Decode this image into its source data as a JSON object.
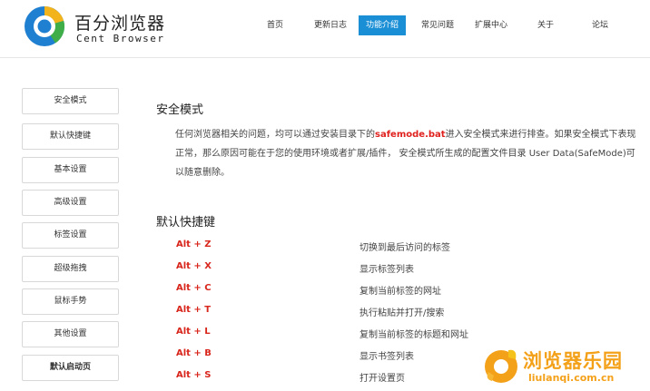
{
  "header": {
    "logo_cn": "百分浏览器",
    "logo_en": "Cent Browser",
    "nav": [
      {
        "label": "首页"
      },
      {
        "label": "更新日志"
      },
      {
        "label": "功能介绍",
        "active": true
      },
      {
        "label": "常见问题"
      },
      {
        "label": "扩展中心"
      },
      {
        "label": "关于"
      },
      {
        "label": "论坛"
      }
    ]
  },
  "sidebar": {
    "items": [
      {
        "label": "安全模式"
      },
      {
        "label": "默认快捷键"
      },
      {
        "label": "基本设置"
      },
      {
        "label": "高级设置"
      },
      {
        "label": "标签设置"
      },
      {
        "label": "超级拖拽"
      },
      {
        "label": "鼠标手势"
      },
      {
        "label": "其他设置"
      },
      {
        "label": "默认启动页",
        "active": true
      }
    ]
  },
  "safe_mode": {
    "title": "安全模式",
    "text_before": "任何浏览器相关的问题，均可以通过安装目录下的",
    "highlight": "safemode.bat",
    "text_after": "进入安全模式来进行排查。如果安全模式下表现正常，那么原因可能在于您的使用环境或者扩展/插件， 安全模式所生成的配置文件目录 User Data(SafeMode)可以随意删除。"
  },
  "shortcuts": {
    "title": "默认快捷键",
    "rows": [
      {
        "key": "Alt + Z",
        "desc": "切换到最后访问的标签"
      },
      {
        "key": "Alt + X",
        "desc": "显示标签列表"
      },
      {
        "key": "Alt + C",
        "desc": "复制当前标签的网址"
      },
      {
        "key": "Alt + T",
        "desc": "执行粘贴并打开/搜索"
      },
      {
        "key": "Alt + L",
        "desc": "复制当前标签的标题和网址"
      },
      {
        "key": "Alt + B",
        "desc": "显示书签列表"
      },
      {
        "key": "Alt + S",
        "desc": "打开设置页"
      }
    ]
  },
  "watermark": {
    "cn": "浏览器乐园",
    "en": "liulanqi.com.cn"
  },
  "colors": {
    "accent": "#1a8fd6",
    "highlight": "#e0221f",
    "watermark": "#f4a11a"
  }
}
